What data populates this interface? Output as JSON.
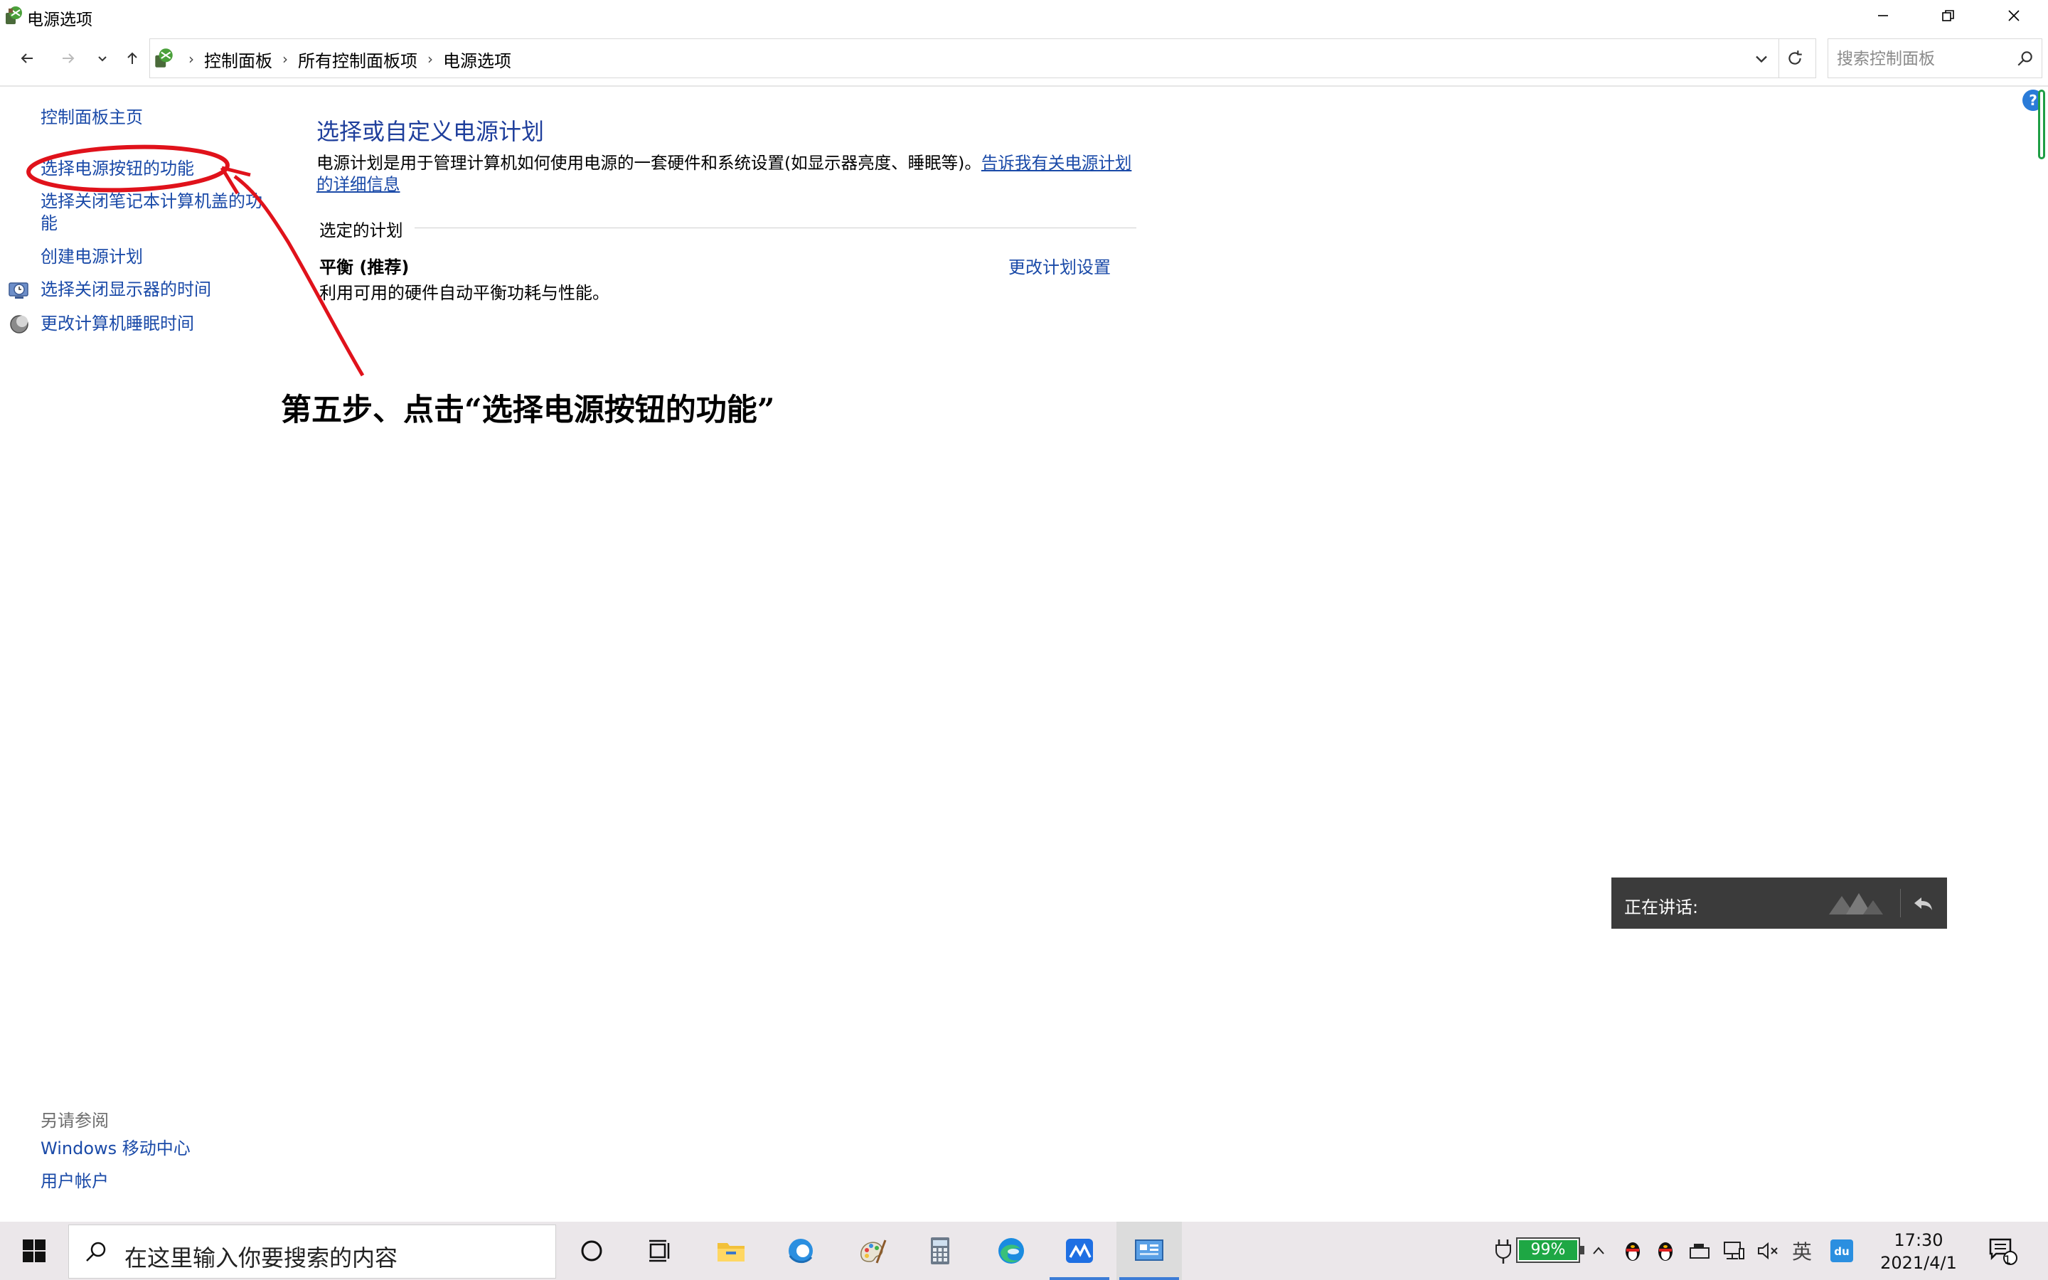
{
  "window": {
    "title": "电源选项",
    "minimize_icon": "minimize-icon",
    "maximize_icon": "restore-icon",
    "close_icon": "close-icon"
  },
  "address_bar": {
    "breadcrumb": [
      "控制面板",
      "所有控制面板项",
      "电源选项"
    ],
    "search_placeholder": "搜索控制面板"
  },
  "left_pane": {
    "items": [
      {
        "label": "控制面板主页",
        "icon": null
      },
      {
        "label": "选择电源按钮的功能",
        "icon": null
      },
      {
        "label": "选择关闭笔记本计算机盖的功能",
        "icon": null
      },
      {
        "label": "创建电源计划",
        "icon": null
      },
      {
        "label": "选择关闭显示器的时间",
        "icon": "display-clock-icon"
      },
      {
        "label": "更改计算机睡眠时间",
        "icon": "sleep-moon-icon"
      }
    ],
    "see_also": {
      "heading": "另请参阅",
      "links": [
        "Windows 移动中心",
        "用户帐户"
      ]
    }
  },
  "main": {
    "heading": "选择或自定义电源计划",
    "description": "电源计划是用于管理计算机如何使用电源的一套硬件和系统设置(如显示器亮度、睡眠等)。",
    "description_link": "告诉我有关电源计划的详细信息",
    "section_label": "选定的计划",
    "plan": {
      "name": "平衡 (推荐)",
      "description": "利用可用的硬件自动平衡功耗与性能。",
      "change_link": "更改计划设置"
    }
  },
  "annotation": {
    "text": "第五步、点击“选择电源按钮的功能”",
    "color": "#e0121b"
  },
  "speaking_popup": {
    "label": "正在讲话:"
  },
  "taskbar": {
    "search_placeholder": "在这里输入你要搜索的内容",
    "battery_percent": "99%",
    "time": "17:30",
    "date": "2021/4/1",
    "notification_count": "1",
    "input_method": "英"
  },
  "colors": {
    "link": "#1a4aa8",
    "heading": "#1f3f9c",
    "taskbar_bg": "#ebe7ea",
    "battery_green": "#1ea744"
  }
}
